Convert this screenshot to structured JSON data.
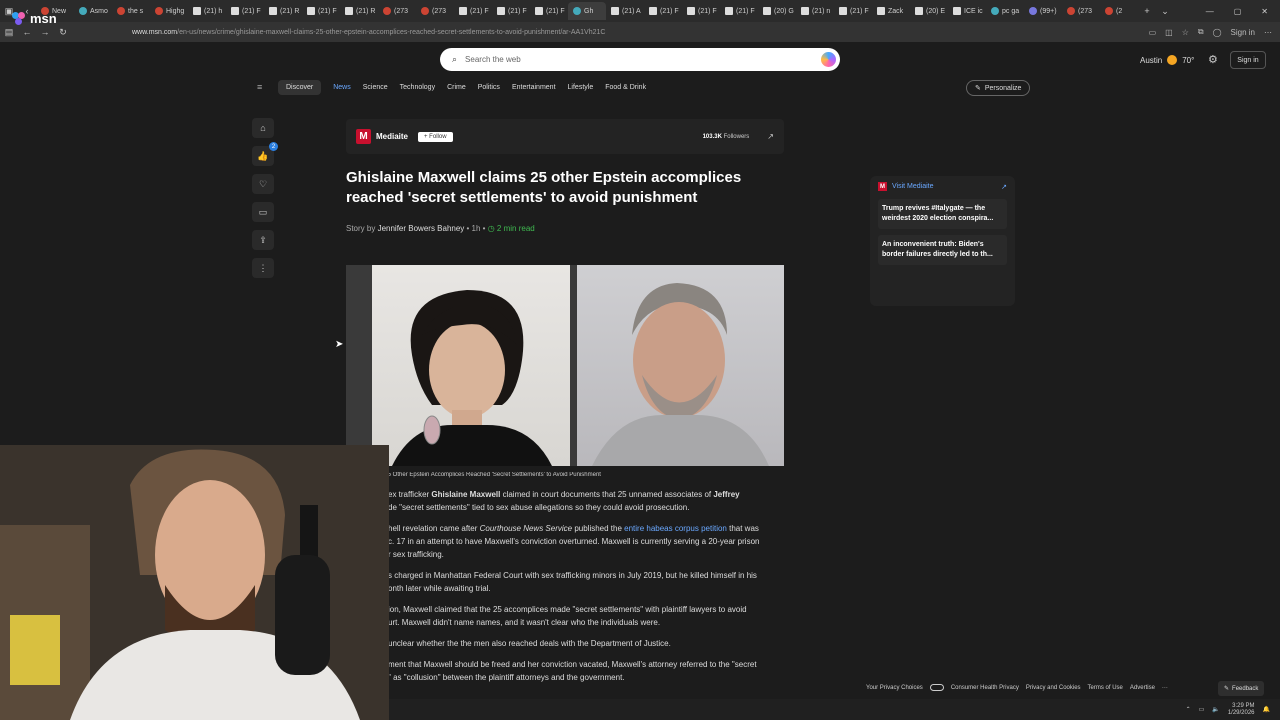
{
  "browser": {
    "tabs": [
      {
        "label": "New"
      },
      {
        "label": "Asmo"
      },
      {
        "label": "the s"
      },
      {
        "label": "Highg"
      },
      {
        "label": "(21) h"
      },
      {
        "label": "(21) F"
      },
      {
        "label": "(21) R"
      },
      {
        "label": "(21) F"
      },
      {
        "label": "(21) R"
      },
      {
        "label": "(273"
      },
      {
        "label": "(273"
      },
      {
        "label": "(21) F"
      },
      {
        "label": "(21) F"
      },
      {
        "label": "(21) F"
      },
      {
        "label": "Gh",
        "active": true
      },
      {
        "label": "(21) A"
      },
      {
        "label": "(21) F"
      },
      {
        "label": "(21) F"
      },
      {
        "label": "(21) F"
      },
      {
        "label": "(20) G"
      },
      {
        "label": "(21) n"
      },
      {
        "label": "(21) F"
      },
      {
        "label": "Zack"
      },
      {
        "label": "(20) E"
      },
      {
        "label": "ICE ic"
      },
      {
        "label": "pc ga"
      },
      {
        "label": "(99+)"
      },
      {
        "label": "(273"
      },
      {
        "label": "(2"
      }
    ],
    "url_host": "www.msn.com",
    "url_path": "/en-us/news/crime/ghislaine-maxwell-claims-25-other-epstein-accomplices-reached-secret-settlements-to-avoid-punishment/ar-AA1Vh21C",
    "profile": "Sign in"
  },
  "header": {
    "logo_text": "msn",
    "search_placeholder": "Search the web",
    "location": "Austin",
    "temperature": "70°",
    "signin": "Sign in"
  },
  "nav": {
    "items": [
      "Discover",
      "News",
      "Science",
      "Technology",
      "Crime",
      "Politics",
      "Entertainment",
      "Lifestyle",
      "Food & Drink"
    ],
    "personalize": "Personalize"
  },
  "rail": {
    "badge": "2"
  },
  "publisher": {
    "logo_letter": "M",
    "name": "Mediaite",
    "follow": "+ Follow",
    "followers_count": "103.3K",
    "followers_label": "Followers"
  },
  "article": {
    "headline": "Ghislaine Maxwell claims 25 other Epstein accomplices reached 'secret settlements' to avoid punishment",
    "byline_prefix": "Story by",
    "author": "Jennifer Bowers Bahney",
    "age": "1h",
    "read_time": "2 min read",
    "caption": "axwell Claims 25 Other Epstein Accomplices Reached 'Secret Settlements' to Avoid Punishment",
    "p1_a": "ex trafficker ",
    "p1_name1": "Ghislaine Maxwell",
    "p1_b": " claimed in court documents that 25 unnamed associates of ",
    "p1_name2": "Jeffrey",
    "p1_c": "de \"secret settlements\" tied to sex abuse allegations so they could avoid prosecution.",
    "p2_a": "hell revelation came after ",
    "p2_italic": "Courthouse News Service",
    "p2_b": " published the ",
    "p2_link": "entire habeas corpus petition",
    "p2_c": " that was",
    "p2_d": "c. 17 in an attempt to have Maxwell's conviction overturned. Maxwell is currently serving a 20-year prison",
    "p2_e": "r sex trafficking.",
    "p3": "s charged in Manhattan Federal Court with sex trafficking minors in July 2019, but he killed himself in his",
    "p3b": "onth later while awaiting trial.",
    "p4": "ion, Maxwell claimed that the 25 accomplices made \"secret settlements\" with plaintiff lawyers to avoid",
    "p4b": "urt. Maxwell didn't name names, and it wasn't clear who the individuals were.",
    "p5": "unclear whether the the men also reached deals with the Department of Justice.",
    "p6": "ment that Maxwell should be freed and her conviction vacated, Maxwell's attorney referred to the \"secret",
    "p6b": "\" as \"collusion\" between the plaintiff attorneys and the government."
  },
  "sidebar": {
    "visit": "Visit Mediaite",
    "items": [
      "Trump revives #Italygate — the weirdest 2020 election conspira...",
      "An inconvenient truth: Biden's border failures directly led to th..."
    ]
  },
  "footer": {
    "links": [
      "Your Privacy Choices",
      "Consumer Health Privacy",
      "Privacy and Cookies",
      "Terms of Use",
      "Advertise"
    ],
    "more": "···",
    "feedback": "Feedback"
  },
  "taskbar": {
    "time": "3:29 PM",
    "date": "1/29/2026"
  }
}
